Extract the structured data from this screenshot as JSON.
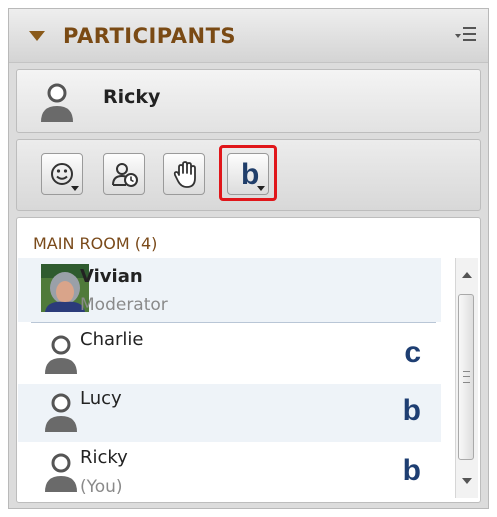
{
  "panel": {
    "title": "PARTICIPANTS",
    "menu_icon": "panel-options-icon"
  },
  "current_user": {
    "name": "Ricky",
    "avatar_icon": "person-icon"
  },
  "toolbar": {
    "buttons": [
      {
        "icon": "emoticon-icon",
        "has_dropdown": true
      },
      {
        "icon": "step-away-icon",
        "has_dropdown": false
      },
      {
        "icon": "raise-hand-icon",
        "has_dropdown": false
      },
      {
        "icon": "status-b-icon",
        "label": "b",
        "has_dropdown": true,
        "highlighted": true
      }
    ]
  },
  "room": {
    "header": "MAIN ROOM (4)",
    "participants": [
      {
        "name": "Vivian",
        "subtitle": "Moderator",
        "status": "",
        "photo": true
      },
      {
        "name": "Charlie",
        "subtitle": "",
        "status": "c"
      },
      {
        "name": "Lucy",
        "subtitle": "",
        "status": "b"
      },
      {
        "name": "Ricky",
        "subtitle": "(You)",
        "status": "b"
      }
    ]
  },
  "colors": {
    "title": "#7a4a14",
    "status_letter": "#1e3e72",
    "highlight_frame": "#e0161a",
    "row_alt": "#eef3f8"
  }
}
